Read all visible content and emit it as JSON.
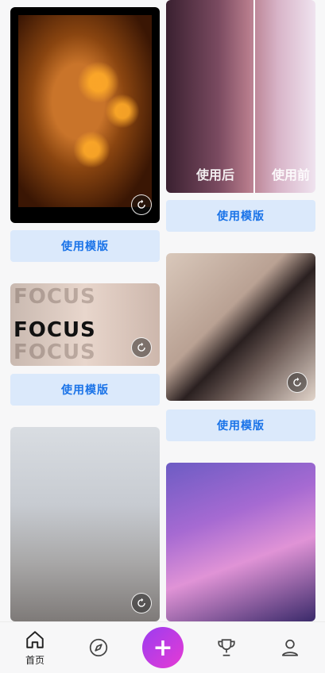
{
  "feed": {
    "use_template_label": "使用模版",
    "cards": [
      {
        "name": "kodak-portrait",
        "has_replay": true
      },
      {
        "name": "before-after",
        "after_label": "使用后",
        "before_label": "使用前",
        "has_replay": false
      },
      {
        "name": "focus-portrait",
        "focus_text": "FOCUS",
        "has_replay": true
      },
      {
        "name": "collage-portrait",
        "has_replay": true
      },
      {
        "name": "snow-portrait",
        "has_replay": true
      },
      {
        "name": "flower-portrait",
        "has_replay": false
      }
    ]
  },
  "tabbar": {
    "home_label": "首页",
    "icons": [
      "home-icon",
      "compass-icon",
      "plus-icon",
      "trophy-icon",
      "profile-icon"
    ]
  },
  "colors": {
    "button_bg": "#dbe9fb",
    "button_text": "#1a73e8",
    "plus_gradient_start": "#9b3cf0",
    "plus_gradient_end": "#e63bd4"
  }
}
